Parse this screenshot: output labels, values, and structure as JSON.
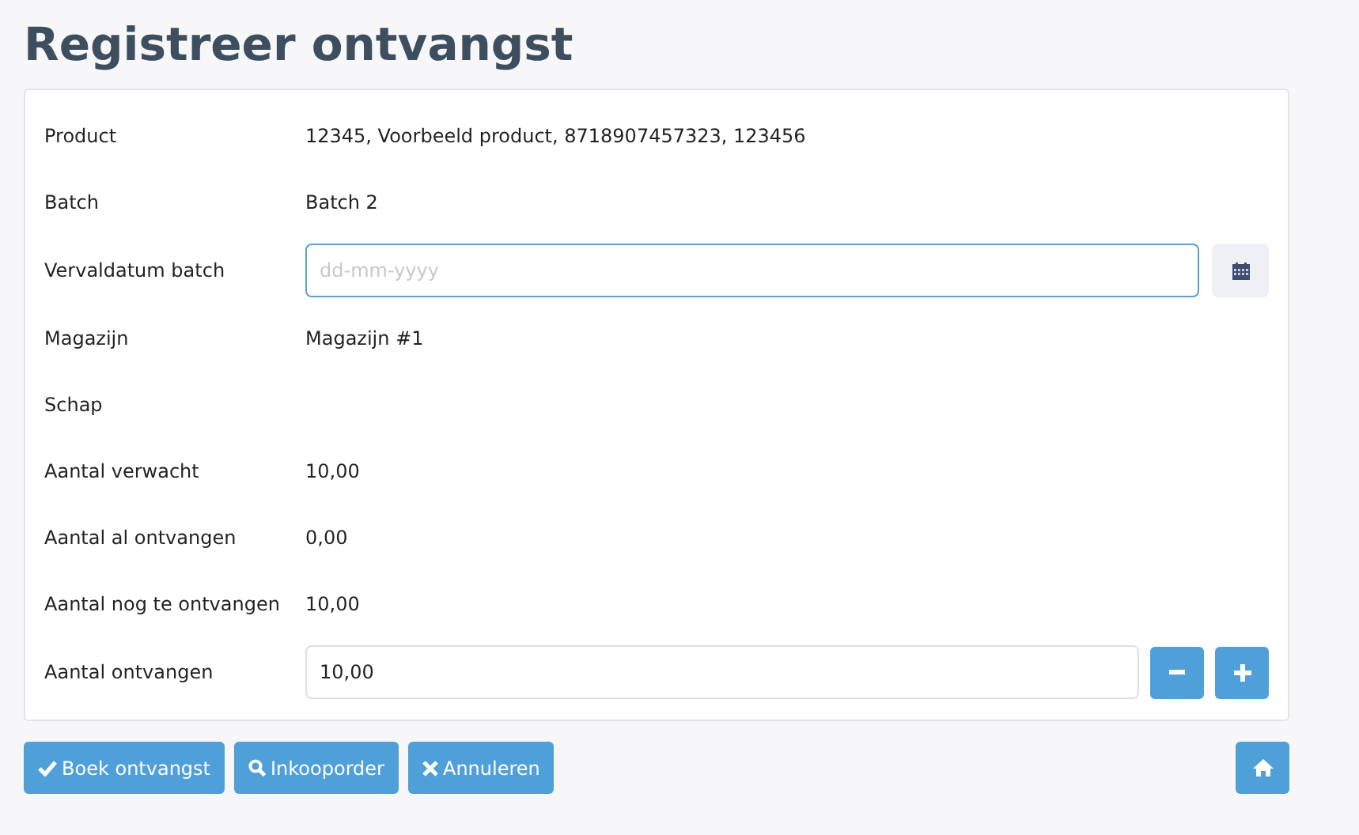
{
  "title": "Registreer ontvangst",
  "rows": [
    {
      "kind": "text",
      "label": "Product",
      "value": "12345, Voorbeeld product, 8718907457323, 123456"
    },
    {
      "kind": "text",
      "label": "Batch",
      "value": "Batch 2"
    },
    {
      "kind": "date",
      "label": "Vervaldatum batch",
      "placeholder": "dd-mm-yyyy"
    },
    {
      "kind": "text",
      "label": "Magazijn",
      "value": "Magazijn #1"
    },
    {
      "kind": "text",
      "label": "Schap"
    },
    {
      "kind": "text",
      "label": "Aantal verwacht",
      "value": "10,00"
    },
    {
      "kind": "text",
      "label": "Aantal al ontvangen",
      "value": "0,00"
    },
    {
      "kind": "text",
      "label": "Aantal nog te ontvangen",
      "value": "10,00"
    },
    {
      "kind": "quantity",
      "label": "Aantal ontvangen",
      "value": "10,00"
    }
  ],
  "buttons": [
    {
      "kind": "check",
      "label": "Boek ontvangst"
    },
    {
      "kind": "search",
      "label": "Inkooporder"
    },
    {
      "kind": "cancel",
      "label": "Annuleren"
    }
  ]
}
